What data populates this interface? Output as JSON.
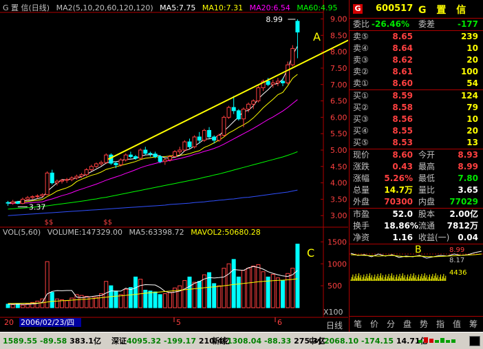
{
  "header": {
    "name": "G 置 信(日线)",
    "ma2": "MA2(5,10,20,60,120,120)",
    "ma5": "MA5:7.75",
    "ma10": "MA10:7.31",
    "ma20": "MA20:6.54",
    "ma60": "MA60:4.95"
  },
  "price_axis": [
    "9.00",
    "8.50",
    "8.00",
    "7.50",
    "7.00",
    "6.50",
    "6.00",
    "5.50",
    "5.00",
    "4.50",
    "4.00",
    "3.50",
    "3.00"
  ],
  "volume_axis": [
    "1500",
    "1000",
    "500"
  ],
  "volume_unit": "X100",
  "annotations": {
    "a": "A",
    "b": "B",
    "c": "C",
    "high": "8.99",
    "low": "3.37",
    "signal": "$$"
  },
  "volume_header": {
    "vol": "VOL(5,60)",
    "volume": "VOLUME:147329.00",
    "ma5": "MA5:63398.72",
    "mavol2": "MAVOL2:50680.28"
  },
  "date_axis": {
    "start": "20",
    "cursor_date": "2006/02/23/四",
    "m5": "5",
    "m6": "6"
  },
  "stock": {
    "badge": "G",
    "code": "600517",
    "name": "G 置 信"
  },
  "committee": {
    "ratio_label": "委比",
    "ratio": "-26.46%",
    "diff_label": "委差",
    "diff": "-177"
  },
  "asks": [
    {
      "label": "卖⑤",
      "price": "8.65",
      "vol": "239"
    },
    {
      "label": "卖④",
      "price": "8.64",
      "vol": "10"
    },
    {
      "label": "卖③",
      "price": "8.62",
      "vol": "20"
    },
    {
      "label": "卖②",
      "price": "8.61",
      "vol": "100"
    },
    {
      "label": "卖①",
      "price": "8.60",
      "vol": "54"
    }
  ],
  "bids": [
    {
      "label": "买①",
      "price": "8.59",
      "vol": "124"
    },
    {
      "label": "买②",
      "price": "8.58",
      "vol": "79"
    },
    {
      "label": "买③",
      "price": "8.56",
      "vol": "10"
    },
    {
      "label": "买④",
      "price": "8.55",
      "vol": "20"
    },
    {
      "label": "买⑤",
      "price": "8.53",
      "vol": "13"
    }
  ],
  "quote": [
    {
      "l1": "现价",
      "v1": "8.60",
      "l2": "今开",
      "v2": "8.93"
    },
    {
      "l1": "涨跌",
      "v1": "0.43",
      "l2": "最高",
      "v2": "8.99"
    },
    {
      "l1": "涨幅",
      "v1": "5.26%",
      "l2": "最低",
      "v2": "7.80"
    },
    {
      "l1": "总量",
      "v1": "14.7万",
      "l2": "量比",
      "v2": "3.65"
    },
    {
      "l1": "外盘",
      "v1": "70300",
      "l2": "内盘",
      "v2": "77029"
    }
  ],
  "finance": [
    {
      "l1": "市盈",
      "v1": "52.0",
      "l2": "股本",
      "v2": "2.00亿"
    },
    {
      "l1": "换手",
      "v1": "18.86%",
      "l2": "流通",
      "v2": "7812万"
    },
    {
      "l1": "净资",
      "v1": "1.16",
      "l2": "收益(一)",
      "v2": "0.04"
    }
  ],
  "mini_chart": {
    "price_hi": "8.99",
    "price_mid": "8.17",
    "vol": "4436"
  },
  "tabs": [
    "笔",
    "价",
    "分",
    "盘",
    "势",
    "指",
    "值",
    "筹"
  ],
  "period_label": "日线",
  "status": {
    "sh_index": "1589.55",
    "sh_change": "-89.58",
    "sh_amount": "383.1亿",
    "sz_label": "深证",
    "sz_index": "4095.32",
    "sz_change": "-199.17",
    "sz_amount": "210.4亿",
    "xz_label": "新综",
    "xz_index": "1308.04",
    "xz_change": "-88.33",
    "xz_amount": "275.3亿",
    "zx_label": "中小",
    "zx_index": "2068.10",
    "zx_change": "-174.15",
    "zx_amount": "14.71亿"
  },
  "colors": {
    "up": "#ff4040",
    "down": "#00ffff",
    "ma5": "#ffffff",
    "ma10": "#ffff00",
    "ma20": "#ff00ff",
    "ma60": "#00ff00",
    "trend": "#ffff00",
    "grid": "#b00000"
  },
  "chart_data": {
    "type": "candlestick",
    "y_range": [
      2.9,
      9.2
    ],
    "candles": [
      [
        3.4,
        3.45,
        3.3,
        3.38
      ],
      [
        3.38,
        3.48,
        3.33,
        3.42
      ],
      [
        3.42,
        3.45,
        3.35,
        3.37
      ],
      [
        3.37,
        3.55,
        3.35,
        3.5
      ],
      [
        3.5,
        3.6,
        3.45,
        3.55
      ],
      [
        3.55,
        3.62,
        3.5,
        3.58
      ],
      [
        3.58,
        3.65,
        3.52,
        3.6
      ],
      [
        3.6,
        3.68,
        3.55,
        3.64
      ],
      [
        3.64,
        4.35,
        3.62,
        4.3
      ],
      [
        4.3,
        4.4,
        3.95,
        4.0
      ],
      [
        4.0,
        4.1,
        3.92,
        4.05
      ],
      [
        4.05,
        4.12,
        3.98,
        4.08
      ],
      [
        4.08,
        4.15,
        4.0,
        4.1
      ],
      [
        4.1,
        4.2,
        4.05,
        4.15
      ],
      [
        4.15,
        4.25,
        4.1,
        4.2
      ],
      [
        4.2,
        4.3,
        4.15,
        4.25
      ],
      [
        4.25,
        4.45,
        4.2,
        4.4
      ],
      [
        4.4,
        4.55,
        4.35,
        4.5
      ],
      [
        4.5,
        4.62,
        4.45,
        4.58
      ],
      [
        4.58,
        4.68,
        4.52,
        4.62
      ],
      [
        4.62,
        4.9,
        4.58,
        4.85
      ],
      [
        4.85,
        4.9,
        4.55,
        4.6
      ],
      [
        4.6,
        4.65,
        4.45,
        4.55
      ],
      [
        4.55,
        4.75,
        4.5,
        4.7
      ],
      [
        4.7,
        4.9,
        4.65,
        4.85
      ],
      [
        4.85,
        4.95,
        4.75,
        4.8
      ],
      [
        4.8,
        4.85,
        4.7,
        4.75
      ],
      [
        4.75,
        5.05,
        4.72,
        5.0
      ],
      [
        5.0,
        5.1,
        4.85,
        4.9
      ],
      [
        4.9,
        4.95,
        4.8,
        4.88
      ],
      [
        4.88,
        4.95,
        4.75,
        4.8
      ],
      [
        4.8,
        4.85,
        4.6,
        4.65
      ],
      [
        4.65,
        4.75,
        4.55,
        4.7
      ],
      [
        4.7,
        4.85,
        4.65,
        4.8
      ],
      [
        4.8,
        5.0,
        4.78,
        4.95
      ],
      [
        4.95,
        5.1,
        4.85,
        5.0
      ],
      [
        5.0,
        5.3,
        4.95,
        5.25
      ],
      [
        5.25,
        5.35,
        5.05,
        5.1
      ],
      [
        5.1,
        5.45,
        5.05,
        5.4
      ],
      [
        5.4,
        5.55,
        5.2,
        5.3
      ],
      [
        5.3,
        5.65,
        5.25,
        5.6
      ],
      [
        5.6,
        5.7,
        5.35,
        5.4
      ],
      [
        5.4,
        5.45,
        5.2,
        5.3
      ],
      [
        5.3,
        5.5,
        5.25,
        5.45
      ],
      [
        5.45,
        6.05,
        5.4,
        6.0
      ],
      [
        6.0,
        6.35,
        5.95,
        6.3
      ],
      [
        6.3,
        6.65,
        6.1,
        6.2
      ],
      [
        6.2,
        6.25,
        5.9,
        5.95
      ],
      [
        5.95,
        6.3,
        5.7,
        6.25
      ],
      [
        6.25,
        6.45,
        6.15,
        6.4
      ],
      [
        6.4,
        6.55,
        6.25,
        6.5
      ],
      [
        6.5,
        7.0,
        6.45,
        6.9
      ],
      [
        6.9,
        7.15,
        6.8,
        7.1
      ],
      [
        7.1,
        7.2,
        6.95,
        7.0
      ],
      [
        7.0,
        7.15,
        6.9,
        7.05
      ],
      [
        7.05,
        7.2,
        6.95,
        7.1
      ],
      [
        7.1,
        7.2,
        6.95,
        7.05
      ],
      [
        7.05,
        7.7,
        7.0,
        7.6
      ],
      [
        7.6,
        8.2,
        7.55,
        8.1
      ],
      [
        8.93,
        8.99,
        7.8,
        8.6
      ]
    ],
    "volume": [
      80,
      70,
      90,
      60,
      85,
      120,
      150,
      200,
      1050,
      350,
      200,
      180,
      160,
      220,
      300,
      280,
      260,
      250,
      240,
      320,
      600,
      500,
      380,
      300,
      420,
      460,
      700,
      650,
      400,
      380,
      360,
      300,
      320,
      350,
      450,
      500,
      620,
      700,
      580,
      600,
      750,
      800,
      550,
      500,
      900,
      1000,
      1100,
      700,
      850,
      900,
      950,
      980,
      820,
      700,
      760,
      680,
      620,
      780,
      900,
      1450
    ],
    "ma5": [
      3.39,
      3.41,
      3.43,
      3.45,
      3.46,
      3.48,
      3.52,
      3.55,
      3.74,
      3.87,
      4.0,
      4.1,
      4.09,
      4.12,
      4.15,
      4.19,
      4.26,
      4.34,
      4.42,
      4.5,
      4.6,
      4.64,
      4.65,
      4.67,
      4.72,
      4.72,
      4.74,
      4.81,
      4.85,
      4.86,
      4.86,
      4.82,
      4.76,
      4.76,
      4.78,
      4.83,
      4.98,
      5.03,
      5.12,
      5.22,
      5.33,
      5.34,
      5.37,
      5.44,
      5.58,
      5.72,
      5.87,
      6.01,
      6.18,
      6.21,
      6.35,
      6.56,
      6.71,
      6.84,
      7.0,
      7.03,
      7.16,
      7.48,
      7.9,
      8.17
    ],
    "ma10": [
      3.38,
      3.39,
      3.4,
      3.41,
      3.43,
      3.45,
      3.47,
      3.49,
      3.58,
      3.66,
      3.75,
      3.8,
      3.85,
      3.92,
      4.04,
      4.11,
      4.17,
      4.23,
      4.27,
      4.33,
      4.41,
      4.45,
      4.49,
      4.53,
      4.57,
      4.61,
      4.65,
      4.71,
      4.75,
      4.77,
      4.79,
      4.79,
      4.8,
      4.82,
      4.84,
      4.84,
      4.86,
      4.89,
      4.94,
      4.98,
      5.08,
      5.14,
      5.22,
      5.3,
      5.4,
      5.52,
      5.6,
      5.69,
      5.77,
      5.86,
      5.98,
      6.13,
      6.29,
      6.42,
      6.55,
      6.69,
      6.76,
      6.96,
      7.19,
      7.31
    ],
    "ma20": [
      3.37,
      3.37,
      3.38,
      3.38,
      3.39,
      3.4,
      3.41,
      3.42,
      3.47,
      3.51,
      3.56,
      3.61,
      3.65,
      3.7,
      3.76,
      3.81,
      3.86,
      3.91,
      3.96,
      4.02,
      4.08,
      4.13,
      4.18,
      4.23,
      4.29,
      4.34,
      4.4,
      4.46,
      4.51,
      4.55,
      4.59,
      4.63,
      4.66,
      4.68,
      4.71,
      4.74,
      4.78,
      4.82,
      4.87,
      4.91,
      4.96,
      5.0,
      5.05,
      5.11,
      5.18,
      5.26,
      5.34,
      5.42,
      5.5,
      5.58,
      5.66,
      5.75,
      5.84,
      5.93,
      6.01,
      6.1,
      6.19,
      6.3,
      6.42,
      6.54
    ],
    "ma60": [
      3.2,
      3.21,
      3.22,
      3.23,
      3.24,
      3.25,
      3.27,
      3.28,
      3.3,
      3.32,
      3.34,
      3.36,
      3.38,
      3.4,
      3.42,
      3.44,
      3.46,
      3.49,
      3.51,
      3.54,
      3.56,
      3.59,
      3.62,
      3.65,
      3.68,
      3.71,
      3.74,
      3.77,
      3.8,
      3.83,
      3.86,
      3.89,
      3.92,
      3.95,
      3.98,
      4.01,
      4.04,
      4.07,
      4.1,
      4.13,
      4.17,
      4.2,
      4.24,
      4.27,
      4.31,
      4.35,
      4.39,
      4.43,
      4.47,
      4.51,
      4.55,
      4.59,
      4.63,
      4.67,
      4.71,
      4.75,
      4.79,
      4.84,
      4.89,
      4.95
    ],
    "ma120": [
      3.0,
      3.01,
      3.02,
      3.03,
      3.04,
      3.05,
      3.06,
      3.07,
      3.08,
      3.09,
      3.1,
      3.11,
      3.12,
      3.13,
      3.14,
      3.15,
      3.16,
      3.17,
      3.18,
      3.19,
      3.2,
      3.21,
      3.22,
      3.23,
      3.24,
      3.25,
      3.26,
      3.27,
      3.28,
      3.29,
      3.3,
      3.31,
      3.32,
      3.34,
      3.35,
      3.36,
      3.37,
      3.38,
      3.4,
      3.41,
      3.42,
      3.44,
      3.45,
      3.47,
      3.48,
      3.5,
      3.51,
      3.53,
      3.55,
      3.56,
      3.58,
      3.6,
      3.62,
      3.64,
      3.66,
      3.68,
      3.7,
      3.72,
      3.75,
      3.78
    ],
    "vol_ma5": [
      80,
      78,
      80,
      77,
      77,
      85,
      95,
      121,
      313,
      371,
      391,
      386,
      392,
      392,
      242,
      228,
      244,
      253,
      270,
      278,
      334,
      382,
      378,
      378,
      444,
      412,
      452,
      506,
      526,
      522,
      518,
      458,
      372,
      342,
      356,
      378,
      428,
      488,
      554,
      596,
      654,
      686,
      676,
      686,
      700,
      770,
      870,
      860,
      850,
      910,
      940,
      918,
      878,
      820,
      782,
      752,
      724,
      712,
      752,
      848
    ],
    "vol_ma60": [
      95,
      96,
      98,
      100,
      102,
      104,
      106,
      110,
      130,
      145,
      150,
      158,
      165,
      172,
      180,
      188,
      195,
      205,
      215,
      228,
      240,
      252,
      262,
      272,
      282,
      292,
      305,
      318,
      330,
      340,
      350,
      360,
      368,
      378,
      388,
      398,
      410,
      422,
      432,
      442,
      455,
      468,
      476,
      486,
      500,
      515,
      530,
      540,
      552,
      565,
      578,
      592,
      600,
      608,
      615,
      622,
      628,
      636,
      645,
      660
    ]
  }
}
